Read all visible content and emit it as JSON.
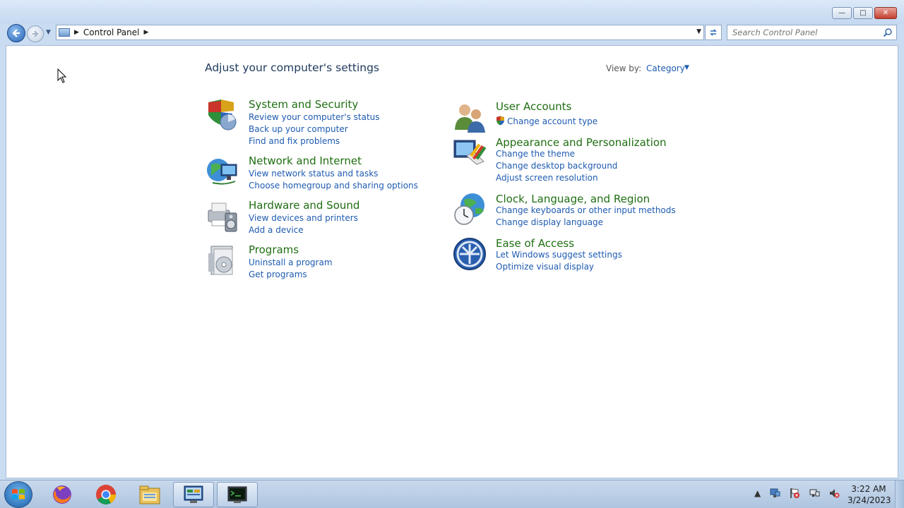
{
  "window": {
    "caption_buttons": {
      "minimize": "—",
      "maximize": "□",
      "close": "✕"
    }
  },
  "nav": {
    "address_path": "Control Panel",
    "search_placeholder": "Search Control Panel"
  },
  "main": {
    "title": "Adjust your computer's settings",
    "view_by_label": "View by:",
    "view_by_value": "Category",
    "categories_left": [
      {
        "title": "System and Security",
        "icon": "shield-pie-icon",
        "links": [
          "Review your computer's status",
          "Back up your computer",
          "Find and fix problems"
        ]
      },
      {
        "title": "Network and Internet",
        "icon": "network-globe-icon",
        "links": [
          "View network status and tasks",
          "Choose homegroup and sharing options"
        ]
      },
      {
        "title": "Hardware and Sound",
        "icon": "printer-speaker-icon",
        "links": [
          "View devices and printers",
          "Add a device"
        ]
      },
      {
        "title": "Programs",
        "icon": "programs-disc-icon",
        "links": [
          "Uninstall a program",
          "Get programs"
        ]
      }
    ],
    "categories_right": [
      {
        "title": "User Accounts",
        "icon": "users-icon",
        "links": [
          "Change account type"
        ]
      },
      {
        "title": "Appearance and Personalization",
        "icon": "monitor-paint-icon",
        "links": [
          "Change the theme",
          "Change desktop background",
          "Adjust screen resolution"
        ]
      },
      {
        "title": "Clock, Language, and Region",
        "icon": "clock-globe-icon",
        "links": [
          "Change keyboards or other input methods",
          "Change display language"
        ]
      },
      {
        "title": "Ease of Access",
        "icon": "ease-of-access-icon",
        "links": [
          "Let Windows suggest settings",
          "Optimize visual display"
        ]
      }
    ]
  },
  "taskbar": {
    "apps": [
      "firefox-icon",
      "chrome-icon",
      "file-explorer-icon",
      "control-panel-icon",
      "terminal-icon"
    ],
    "time": "3:22 AM",
    "date": "3/24/2023"
  },
  "colors": {
    "category_title": "#1f6e12",
    "link": "#1e5bb0",
    "heading": "#1e395b"
  }
}
